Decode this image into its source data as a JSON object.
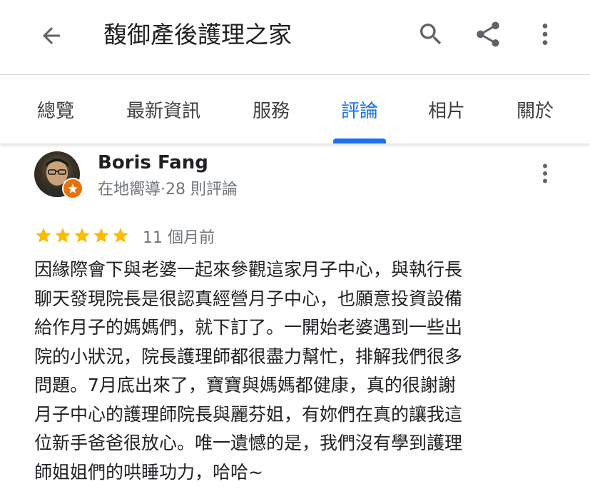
{
  "header": {
    "title": "馥御產後護理之家",
    "back_icon": "arrow-back-icon",
    "actions": [
      "search-icon",
      "share-icon",
      "more-vert-icon"
    ]
  },
  "tabs": [
    {
      "label": "總覽",
      "active": false
    },
    {
      "label": "最新資訊",
      "active": false
    },
    {
      "label": "服務",
      "active": false
    },
    {
      "label": "評論",
      "active": true
    },
    {
      "label": "相片",
      "active": false
    },
    {
      "label": "關於",
      "active": false
    }
  ],
  "review": {
    "reviewer_name": "Boris Fang",
    "reviewer_meta": "在地嚮導·28 則評論",
    "rating": 5,
    "rating_max": 5,
    "time": "11 個月前",
    "text_lines": [
      "因緣際會下與老婆一起來參觀這家月子中心，與執行長",
      "聊天發現院長是很認真經營月子中心，也願意投資設備",
      "給作月子的媽媽們，就下訂了。一開始老婆遇到一些出",
      "院的小狀況，院長護理師都很盡力幫忙，排解我們很多",
      "問題。7月底出來了，寶寶與媽媽都健康，真的很謝謝",
      "月子中心的護理師院長與麗芬姐，有妳們在真的讓我這",
      "位新手爸爸很放心。唯一遺憾的是，我們沒有學到護理",
      "師姐姐們的哄睡功力，哈哈~"
    ]
  },
  "colors": {
    "accent": "#1a73e8",
    "star": "#fbbc04",
    "guide_badge": "#e8710a",
    "secondary_text": "#70757a"
  }
}
